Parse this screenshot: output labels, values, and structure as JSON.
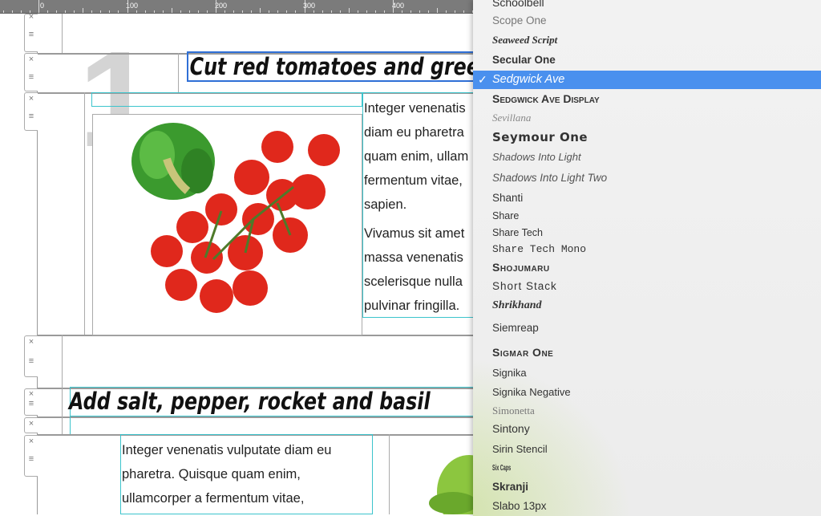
{
  "ruler": {
    "labels": [
      "0",
      "100",
      "200",
      "300",
      "400"
    ]
  },
  "document": {
    "step_number": "1",
    "heading1": "Cut red tomatoes and green",
    "paragraph1": [
      "Integer venenatis",
      "diam eu pharetra",
      "quam enim, ullam",
      "fermentum vitae,",
      "sapien."
    ],
    "paragraph2": [
      "Vivamus sit amet",
      "massa venenatis",
      "scelerisque nulla",
      "pulvinar fringilla."
    ],
    "heading2": "Add salt, pepper, rocket and basil",
    "paragraph3": [
      "Integer venenatis vulputate diam eu",
      "pharetra. Quisque quam enim,",
      "ullamcorper a fermentum vitae,"
    ]
  },
  "row_controls": {
    "remove_icon": "×",
    "drag_icon": "≡"
  },
  "font_menu": {
    "selected": "Sedgwick Ave",
    "check_icon": "✓",
    "highlight_color": "#4a90ee",
    "items": [
      "Schoolbell",
      "Scope One",
      "Seaweed Script",
      "Secular One",
      "Sedgwick Ave",
      "Sedgwick Ave Display",
      "Sevillana",
      "Seymour One",
      "Shadows Into Light",
      "Shadows Into Light Two",
      "Shanti",
      "Share",
      "Share Tech",
      "Share Tech Mono",
      "Shojumaru",
      "Short Stack",
      "Shrikhand",
      "Siemreap",
      "Sigmar One",
      "Signika",
      "Signika Negative",
      "Simonetta",
      "Sintony",
      "Sirin Stencil",
      "Six Caps",
      "Skranji",
      "Slabo 13px"
    ]
  }
}
